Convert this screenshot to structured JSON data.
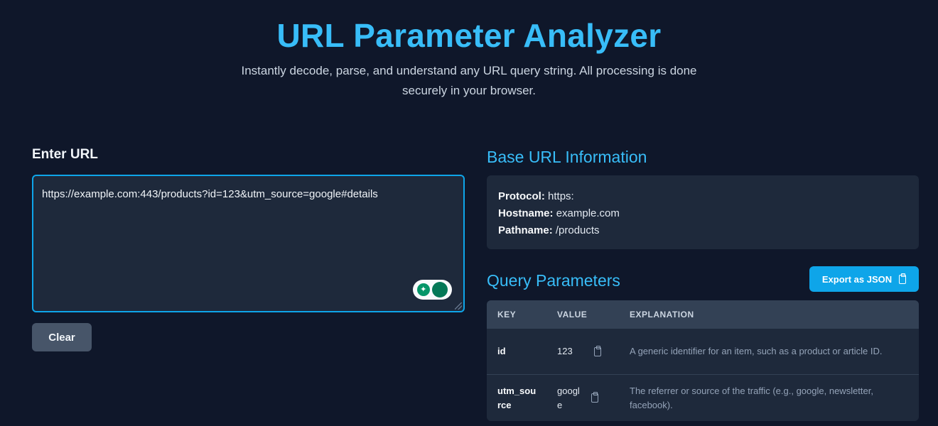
{
  "header": {
    "title": "URL Parameter Analyzer",
    "subtitle": "Instantly decode, parse, and understand any URL query string. All processing is done securely in your browser."
  },
  "input": {
    "label": "Enter URL",
    "value": "https://example.com:443/products?id=123&utm_source=google#details",
    "clear_label": "Clear"
  },
  "base_info": {
    "title": "Base URL Information",
    "protocol_label": "Protocol:",
    "protocol": "https:",
    "hostname_label": "Hostname:",
    "hostname": "example.com",
    "pathname_label": "Pathname:",
    "pathname": "/products"
  },
  "query": {
    "title": "Query Parameters",
    "export_label": "Export as JSON",
    "columns": [
      "KEY",
      "VALUE",
      "EXPLANATION"
    ],
    "rows": [
      {
        "key": "id",
        "value": "123",
        "explanation": "A generic identifier for an item, such as a product or article ID."
      },
      {
        "key": "utm_source",
        "value": "google",
        "explanation": "The referrer or source of the traffic (e.g., google, newsletter, facebook)."
      }
    ]
  },
  "colors": {
    "background": "#0f172a",
    "accent": "#38bdf8",
    "button_primary": "#0ea5e9",
    "card": "#1e293b"
  },
  "icons": {
    "copy": "clipboard-icon",
    "extension": "grammarly-extension-icon"
  }
}
